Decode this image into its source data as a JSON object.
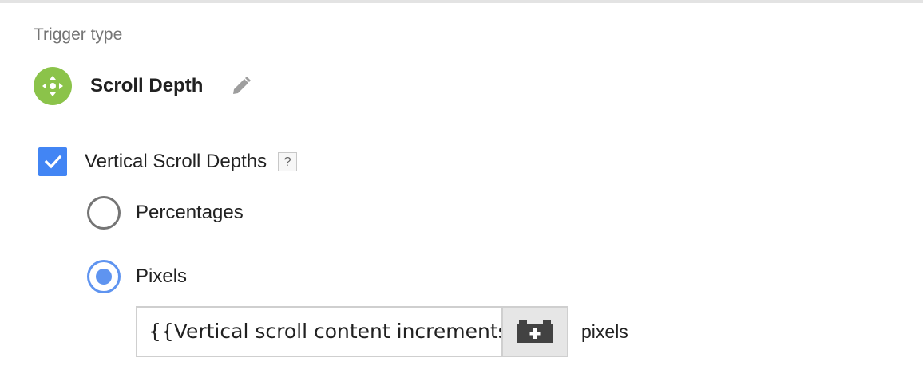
{
  "trigger": {
    "section_label": "Trigger type",
    "name": "Scroll Depth",
    "icon": "move-arrows-icon",
    "icon_color": "#8bc34a"
  },
  "vertical_scroll": {
    "checkbox_label": "Vertical Scroll Depths",
    "checked": true,
    "help_label": "?",
    "accent_color": "#4285f4",
    "options": [
      {
        "label": "Percentages",
        "selected": false
      },
      {
        "label": "Pixels",
        "selected": true
      }
    ],
    "pixels_input_value": "{{Vertical scroll content increments}}",
    "unit_label": "pixels",
    "variable_button_icon": "variable-brick-icon"
  }
}
